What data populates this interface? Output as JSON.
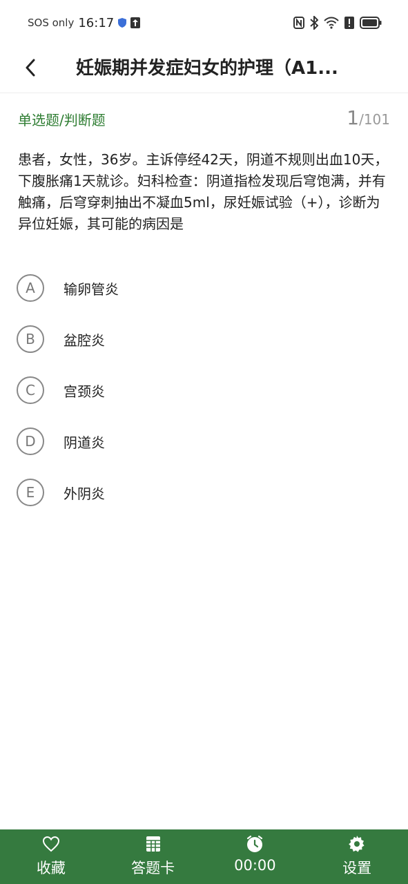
{
  "status": {
    "carrier": "SOS only",
    "time": "16:17"
  },
  "header": {
    "title": "妊娠期并发症妇女的护理（A1..."
  },
  "question": {
    "type_label": "单选题/判断题",
    "current": "1",
    "total": "/101",
    "text": "患者，女性，36岁。主诉停经42天，阴道不规则出血10天，下腹胀痛1天就诊。妇科检查：阴道指检发现后穹饱满，并有触痛，后穹穿刺抽出不凝血5ml，尿妊娠试验（+），诊断为异位妊娠，其可能的病因是"
  },
  "options": [
    {
      "letter": "A",
      "text": "输卵管炎"
    },
    {
      "letter": "B",
      "text": "盆腔炎"
    },
    {
      "letter": "C",
      "text": "宫颈炎"
    },
    {
      "letter": "D",
      "text": "阴道炎"
    },
    {
      "letter": "E",
      "text": "外阴炎"
    }
  ],
  "bottom_bar": {
    "favorite": "收藏",
    "answer_card": "答题卡",
    "timer": "00:00",
    "settings": "设置"
  },
  "colors": {
    "accent": "#2e7d32",
    "bottom_bar_bg": "#357a3f"
  }
}
